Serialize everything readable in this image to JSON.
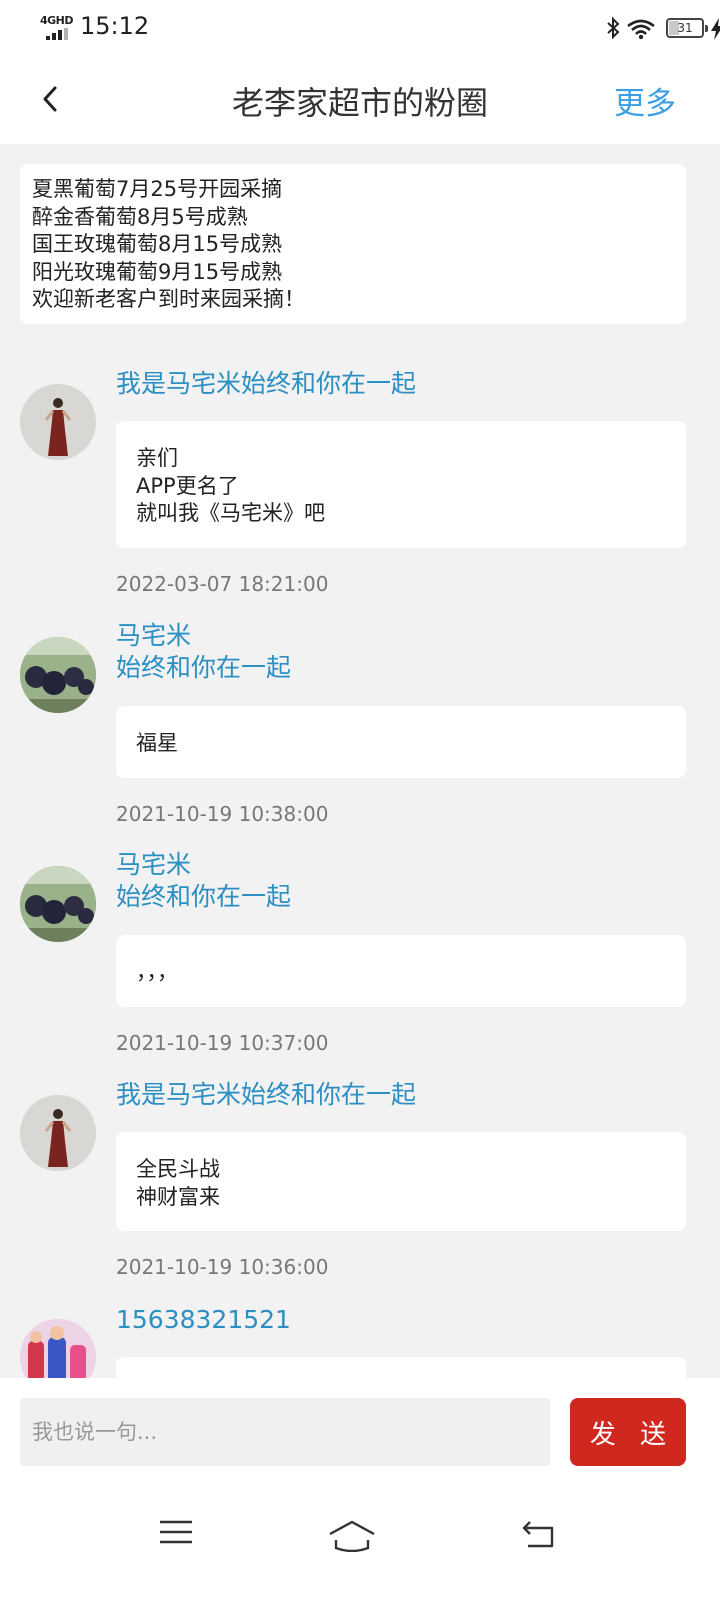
{
  "status_bar": {
    "network": "4GHD",
    "time": "15:12",
    "battery_level": "31",
    "battery_fraction": 0.31,
    "icons": [
      "signal-icon",
      "bluetooth-icon",
      "wifi-icon",
      "battery-icon",
      "charging-icon"
    ]
  },
  "header": {
    "back_icon": "chevron-left-icon",
    "title": "老李家超市的粉圈",
    "more_label": "更多",
    "accent_color": "#3ba0e3"
  },
  "notice": {
    "lines": [
      "夏黑葡萄7月25号开园采摘",
      "醉金香葡萄8月5号成熟",
      "国王玫瑰葡萄8月15号成熟",
      "阳光玫瑰葡萄9月15号成熟",
      "欢迎新老客户到时来园采摘！"
    ]
  },
  "posts": [
    {
      "author_lines": [
        "我是马宅米始终和你在一起"
      ],
      "message_lines": [
        "亲们",
        "APP更名了",
        "就叫我《马宅米》吧"
      ],
      "time": "2022-03-07 18:21:00"
    },
    {
      "author_lines": [
        "马宅米",
        "始终和你在一起"
      ],
      "message_lines": [
        "福星"
      ],
      "time": "2021-10-19 10:38:00"
    },
    {
      "author_lines": [
        "马宅米",
        "始终和你在一起"
      ],
      "message_lines": [
        "，，，"
      ],
      "time": "2021-10-19 10:37:00"
    },
    {
      "author_lines": [
        "我是马宅米始终和你在一起"
      ],
      "message_lines": [
        "全民斗战",
        "神财富来"
      ],
      "time": "2021-10-19 10:36:00"
    },
    {
      "author_lines": [
        "15638321521"
      ],
      "message_lines": [],
      "time": ""
    }
  ],
  "composer": {
    "placeholder": "我也说一句...",
    "send_label": "发 送",
    "send_color": "#d0271e"
  },
  "system_nav": {
    "icons": [
      "menu-icon",
      "home-icon",
      "back-icon"
    ]
  },
  "colors": {
    "author_name": "#2b8fc3",
    "background": "#f2f2f2"
  }
}
